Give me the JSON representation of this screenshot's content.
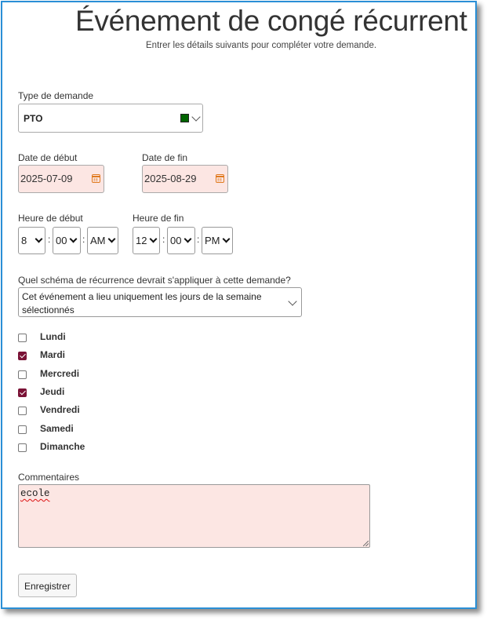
{
  "header": {
    "title": "Événement de congé récurrent",
    "subtitle": "Entrer les détails suivants pour compléter votre demande."
  },
  "request_type": {
    "label": "Type de demande",
    "value": "PTO",
    "color": "#006400"
  },
  "start_date": {
    "label": "Date de début",
    "value": "2025-07-09"
  },
  "end_date": {
    "label": "Date de fin",
    "value": "2025-08-29"
  },
  "start_time": {
    "label": "Heure de début",
    "hour": "8",
    "minute": "00",
    "ampm": "AM"
  },
  "end_time": {
    "label": "Heure de fin",
    "hour": "12",
    "minute": "00",
    "ampm": "PM"
  },
  "time_separator": ":",
  "recurrence": {
    "label": "Quel schéma de récurrence devrait s'appliquer à cette demande?",
    "value_line1": "Cet événement a lieu uniquement les jours de la semaine",
    "value_line2": "sélectionnés"
  },
  "days": [
    {
      "label": "Lundi",
      "checked": false
    },
    {
      "label": "Mardi",
      "checked": true
    },
    {
      "label": "Mercredi",
      "checked": false
    },
    {
      "label": "Jeudi",
      "checked": true
    },
    {
      "label": "Vendredi",
      "checked": false
    },
    {
      "label": "Samedi",
      "checked": false
    },
    {
      "label": "Dimanche",
      "checked": false
    }
  ],
  "comments": {
    "label": "Commentaires",
    "value": "ecole"
  },
  "actions": {
    "save_label": "Enregistrer"
  },
  "colors": {
    "accent_border": "#2a8fd6",
    "checkbox_checked": "#7a1236",
    "field_highlight": "#fce6e3",
    "calendar_icon": "#e07a1f"
  },
  "icons": {
    "date_picker": "calendar-icon",
    "dropdown": "chevron-down-icon"
  }
}
